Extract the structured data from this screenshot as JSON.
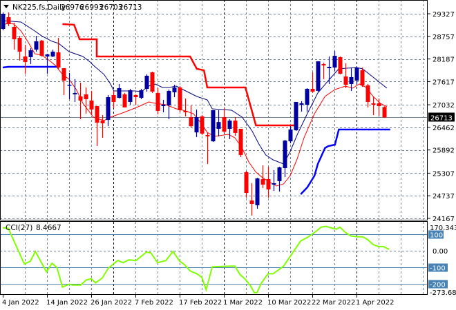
{
  "header": {
    "symbol": "NK225.fs,Daily",
    "open": "26976",
    "high": "26993",
    "low": "26703",
    "close": "26713"
  },
  "colors": {
    "bull": "#0000a0",
    "bear": "#ff0000",
    "fast_ma": "#ff0000",
    "slow_ma": "#000080",
    "upper_stop": "#ff0000",
    "lower_stop": "#0000ff",
    "cci": "#80ff00",
    "cci_levels": "#4682b4",
    "grid": "#708090"
  },
  "chart_data": [
    {
      "type": "candlestick",
      "title": "NK225.fs,Daily",
      "ylim": [
        24167,
        29327
      ],
      "y_ticks": [
        "29327",
        "28757",
        "28187",
        "27617",
        "27032",
        "26462",
        "25892",
        "25307",
        "24737",
        "24167"
      ],
      "current_price_label": "26713",
      "current_price": 26713,
      "x_tick_labels": [
        {
          "bar": 0,
          "label": "4 Jan 2022"
        },
        {
          "bar": 8,
          "label": "14 Jan 2022"
        },
        {
          "bar": 16,
          "label": "26 Jan 2022"
        },
        {
          "bar": 24,
          "label": "7 Feb 2022"
        },
        {
          "bar": 32,
          "label": "17 Feb 2022"
        },
        {
          "bar": 40,
          "label": "1 Mar 2022"
        },
        {
          "bar": 48,
          "label": "10 Mar 2022"
        },
        {
          "bar": 56,
          "label": "22 Mar 2022"
        },
        {
          "bar": 64,
          "label": "1 Apr 2022"
        }
      ],
      "month_separators_bar": [
        20,
        40,
        64
      ],
      "candles_ohlc": [
        [
          28945,
          29362,
          28911,
          29327
        ],
        [
          29241,
          29362,
          29015,
          29067
        ],
        [
          28997,
          29102,
          28424,
          28685
        ],
        [
          28719,
          28772,
          28146,
          28372
        ],
        [
          28250,
          28545,
          27816,
          28111
        ],
        [
          28233,
          28459,
          28059,
          28407
        ],
        [
          28424,
          28772,
          28372,
          28633
        ],
        [
          28650,
          28667,
          28250,
          28268
        ],
        [
          28250,
          28320,
          27816,
          28303
        ],
        [
          28250,
          28424,
          28233,
          28372
        ],
        [
          28355,
          28719,
          27938,
          27972
        ],
        [
          27955,
          27955,
          27277,
          27642
        ],
        [
          27521,
          27833,
          27173,
          27538
        ],
        [
          27295,
          27677,
          27104,
          27330
        ],
        [
          27243,
          27590,
          26669,
          27138
        ],
        [
          27295,
          27468,
          26808,
          27173
        ],
        [
          27138,
          27382,
          26773,
          26913
        ],
        [
          26999,
          26999,
          25991,
          26580
        ],
        [
          26632,
          26773,
          26200,
          26565
        ],
        [
          26650,
          27277,
          26493,
          27225
        ],
        [
          27277,
          27382,
          26947,
          27104
        ],
        [
          27208,
          27555,
          27190,
          27451
        ],
        [
          27295,
          27330,
          26965,
          26965
        ],
        [
          27104,
          27434,
          27034,
          27399
        ],
        [
          27277,
          27295,
          27034,
          27225
        ],
        [
          27208,
          27434,
          27173,
          27399
        ],
        [
          27434,
          27799,
          27364,
          27764
        ],
        [
          27851,
          27868,
          27330,
          27364
        ],
        [
          27330,
          27451,
          26791,
          26878
        ],
        [
          26999,
          27156,
          26843,
          27034
        ],
        [
          27017,
          27416,
          26669,
          27382
        ],
        [
          27347,
          27538,
          27225,
          27468
        ],
        [
          27468,
          27503,
          26843,
          26895
        ],
        [
          26878,
          27190,
          26739,
          26843
        ],
        [
          26721,
          27017,
          26461,
          26493
        ],
        [
          26335,
          26913,
          26218,
          26721
        ],
        [
          26739,
          26773,
          26270,
          26305
        ],
        [
          26270,
          26322,
          25540,
          26235
        ],
        [
          26111,
          26895,
          26094,
          26895
        ],
        [
          26426,
          26895,
          26235,
          26597
        ],
        [
          26721,
          26947,
          26322,
          26353
        ],
        [
          26426,
          26669,
          26165,
          26632
        ],
        [
          26632,
          26721,
          26252,
          26322
        ],
        [
          26426,
          26426,
          25714,
          25766
        ],
        [
          25332,
          25366,
          24689,
          24810
        ],
        [
          24619,
          25053,
          24237,
          24532
        ],
        [
          24498,
          25192,
          24411,
          25175
        ],
        [
          25158,
          25505,
          24932,
          25019
        ],
        [
          25158,
          25470,
          24689,
          24897
        ],
        [
          25019,
          25384,
          24862,
          25053
        ],
        [
          25106,
          25470,
          24845,
          25453
        ],
        [
          25436,
          26148,
          25210,
          26128
        ],
        [
          26111,
          26493,
          26061,
          26409
        ],
        [
          26389,
          27104,
          26371,
          27104
        ],
        [
          27034,
          27121,
          26860,
          27069
        ],
        [
          27034,
          27451,
          26860,
          27434
        ],
        [
          27434,
          27851,
          27330,
          27364
        ],
        [
          27382,
          28129,
          27364,
          28129
        ],
        [
          28059,
          28094,
          27677,
          28025
        ],
        [
          27955,
          28250,
          27555,
          27990
        ],
        [
          27972,
          28389,
          27886,
          28268
        ],
        [
          28233,
          28250,
          27799,
          27816
        ],
        [
          27746,
          28077,
          27451,
          27538
        ],
        [
          27555,
          27972,
          27382,
          27729
        ],
        [
          27642,
          27990,
          27538,
          27972
        ],
        [
          27903,
          27972,
          27486,
          27521
        ],
        [
          27521,
          27555,
          26965,
          27104
        ],
        [
          27069,
          27243,
          26773,
          27034
        ],
        [
          27069,
          27190,
          26756,
          26999
        ],
        [
          26976,
          26993,
          26703,
          26713
        ]
      ],
      "overlays": [
        {
          "name": "slow-ma",
          "points": [
            [
              0,
              29154
            ],
            [
              3.3,
              29119
            ],
            [
              5.8,
              28893
            ],
            [
              7,
              28772
            ],
            [
              8.9,
              28633
            ],
            [
              10.1,
              28580
            ],
            [
              12,
              28372
            ],
            [
              14.5,
              28250
            ],
            [
              15.8,
              28111
            ],
            [
              16.4,
              28025
            ],
            [
              18.3,
              27799
            ],
            [
              19.5,
              27555
            ],
            [
              20.1,
              27382
            ],
            [
              23.9,
              27382
            ],
            [
              25.1,
              27364
            ],
            [
              26.4,
              27503
            ],
            [
              27.6,
              27555
            ],
            [
              28.9,
              27468
            ],
            [
              30.1,
              27468
            ],
            [
              31.4,
              27503
            ],
            [
              32.6,
              27416
            ],
            [
              35.1,
              27243
            ],
            [
              37,
              27156
            ],
            [
              37.9,
              26930
            ],
            [
              41.4,
              26895
            ],
            [
              43.3,
              26721
            ],
            [
              45.1,
              26374
            ],
            [
              46.4,
              26026
            ],
            [
              47.6,
              25766
            ],
            [
              48.9,
              25644
            ],
            [
              50.8,
              25540
            ],
            [
              52,
              25853
            ],
            [
              53.3,
              26287
            ],
            [
              55.1,
              26808
            ],
            [
              57,
              27330
            ],
            [
              58.9,
              27642
            ],
            [
              60.8,
              27938
            ],
            [
              63.9,
              27972
            ],
            [
              65.1,
              27938
            ],
            [
              67,
              27729
            ],
            [
              69.5,
              27451
            ]
          ]
        },
        {
          "name": "fast-ma",
          "points": [
            [
              0,
              29032
            ],
            [
              1,
              29102
            ],
            [
              2,
              29067
            ],
            [
              3.3,
              28893
            ],
            [
              4.5,
              28633
            ],
            [
              5.8,
              28320
            ],
            [
              7,
              28285
            ],
            [
              8.3,
              28163
            ],
            [
              9.5,
              28025
            ],
            [
              10.8,
              27799
            ],
            [
              12,
              27677
            ],
            [
              13.3,
              27416
            ],
            [
              14.5,
              27069
            ],
            [
              16.4,
              26721
            ],
            [
              18.3,
              26632
            ],
            [
              19.5,
              26721
            ],
            [
              22,
              26843
            ],
            [
              24.5,
              26982
            ],
            [
              26.4,
              27104
            ],
            [
              27.6,
              27069
            ],
            [
              29.5,
              27034
            ],
            [
              31.4,
              26930
            ],
            [
              32.6,
              26895
            ],
            [
              34.5,
              26808
            ],
            [
              35.8,
              26580
            ],
            [
              37,
              26335
            ],
            [
              38.3,
              26235
            ],
            [
              40.8,
              26287
            ],
            [
              42,
              26200
            ],
            [
              43.3,
              25940
            ],
            [
              44.5,
              25592
            ],
            [
              45.8,
              25332
            ],
            [
              47,
              25192
            ],
            [
              49.5,
              24984
            ],
            [
              50.8,
              25036
            ],
            [
              52,
              25245
            ],
            [
              53.3,
              25679
            ],
            [
              54.5,
              26200
            ],
            [
              56.4,
              26808
            ],
            [
              58.3,
              27243
            ],
            [
              60.1,
              27416
            ],
            [
              62,
              27503
            ],
            [
              63.3,
              27451
            ],
            [
              64.5,
              27555
            ],
            [
              65.8,
              27468
            ],
            [
              67,
              27243
            ],
            [
              68.3,
              27069
            ],
            [
              69.5,
              26982
            ]
          ]
        },
        {
          "name": "upper-stop",
          "points": [
            [
              10.8,
              29067
            ],
            [
              12.9,
              29050
            ],
            [
              13.9,
              28685
            ],
            [
              17,
              28685
            ],
            [
              17,
              28250
            ],
            [
              33.9,
              28250
            ],
            [
              35.1,
              27938
            ],
            [
              36.4,
              27903
            ],
            [
              37,
              27468
            ],
            [
              43.9,
              27468
            ],
            [
              45.8,
              26513
            ],
            [
              53,
              26513
            ]
          ]
        },
        {
          "name": "lower-stop-early",
          "points": [
            [
              0,
              27972
            ],
            [
              1,
              27990
            ],
            [
              10.1,
              27990
            ]
          ]
        },
        {
          "name": "lower-stop-late",
          "points": [
            [
              53.9,
              24775
            ],
            [
              55.1,
              24949
            ],
            [
              56.4,
              25245
            ],
            [
              57,
              25540
            ],
            [
              58.3,
              25940
            ],
            [
              58.9,
              25991
            ],
            [
              60.1,
              26026
            ],
            [
              60.8,
              26409
            ],
            [
              70.1,
              26409
            ]
          ]
        }
      ]
    },
    {
      "type": "line",
      "title": "CCI(27) 8.4667",
      "name_label": "CCI(27)",
      "value_label": "8.4667",
      "ylim": [
        -273.68,
        170.3435
      ],
      "y_tick_labels": {
        "max": "170.3435",
        "zero": "0.00",
        "min": "-273.680"
      },
      "levels": [
        {
          "value": 100,
          "label": "100"
        },
        {
          "value": -100,
          "label": "-100"
        },
        {
          "value": -200,
          "label": "-200"
        }
      ],
      "points": [
        [
          0,
          139
        ],
        [
          1,
          135
        ],
        [
          3.9,
          -80
        ],
        [
          5,
          -63
        ],
        [
          5.9,
          -4
        ],
        [
          7.9,
          -127
        ],
        [
          8.9,
          -76
        ],
        [
          9.8,
          -101
        ],
        [
          10.8,
          -219
        ],
        [
          12,
          -203
        ],
        [
          12.6,
          -207
        ],
        [
          14.1,
          -207
        ],
        [
          15.1,
          -177
        ],
        [
          16,
          -169
        ],
        [
          16.8,
          -194
        ],
        [
          18,
          -165
        ],
        [
          19.1,
          -106
        ],
        [
          20.8,
          -59
        ],
        [
          21.8,
          -72
        ],
        [
          22.8,
          -55
        ],
        [
          24.1,
          -59
        ],
        [
          26,
          -8
        ],
        [
          26.8,
          -13
        ],
        [
          28,
          -72
        ],
        [
          29.5,
          -59
        ],
        [
          30.8,
          -4
        ],
        [
          32,
          -63
        ],
        [
          32.9,
          -84
        ],
        [
          33.9,
          -122
        ],
        [
          35.1,
          -139
        ],
        [
          36,
          -160
        ],
        [
          36.8,
          -236
        ],
        [
          37.9,
          -97
        ],
        [
          41.5,
          -93
        ],
        [
          42,
          -93
        ],
        [
          42.9,
          -143
        ],
        [
          43.9,
          -173
        ],
        [
          44.8,
          -211
        ],
        [
          45.5,
          -253
        ],
        [
          46,
          -253
        ],
        [
          46.8,
          -194
        ],
        [
          48,
          -139
        ],
        [
          48.9,
          -139
        ],
        [
          49.8,
          -118
        ],
        [
          50.8,
          -93
        ],
        [
          52,
          -34
        ],
        [
          53.9,
          59
        ],
        [
          55.1,
          80
        ],
        [
          56.4,
          110
        ],
        [
          57.6,
          143
        ],
        [
          58.5,
          148
        ],
        [
          59.8,
          135
        ],
        [
          60.4,
          131
        ],
        [
          61,
          143
        ],
        [
          62,
          110
        ],
        [
          63,
          89
        ],
        [
          64.3,
          84
        ],
        [
          65.1,
          84
        ],
        [
          66,
          68
        ],
        [
          67,
          38
        ],
        [
          68,
          25
        ],
        [
          68.9,
          25
        ],
        [
          69.9,
          8.47
        ]
      ]
    }
  ]
}
